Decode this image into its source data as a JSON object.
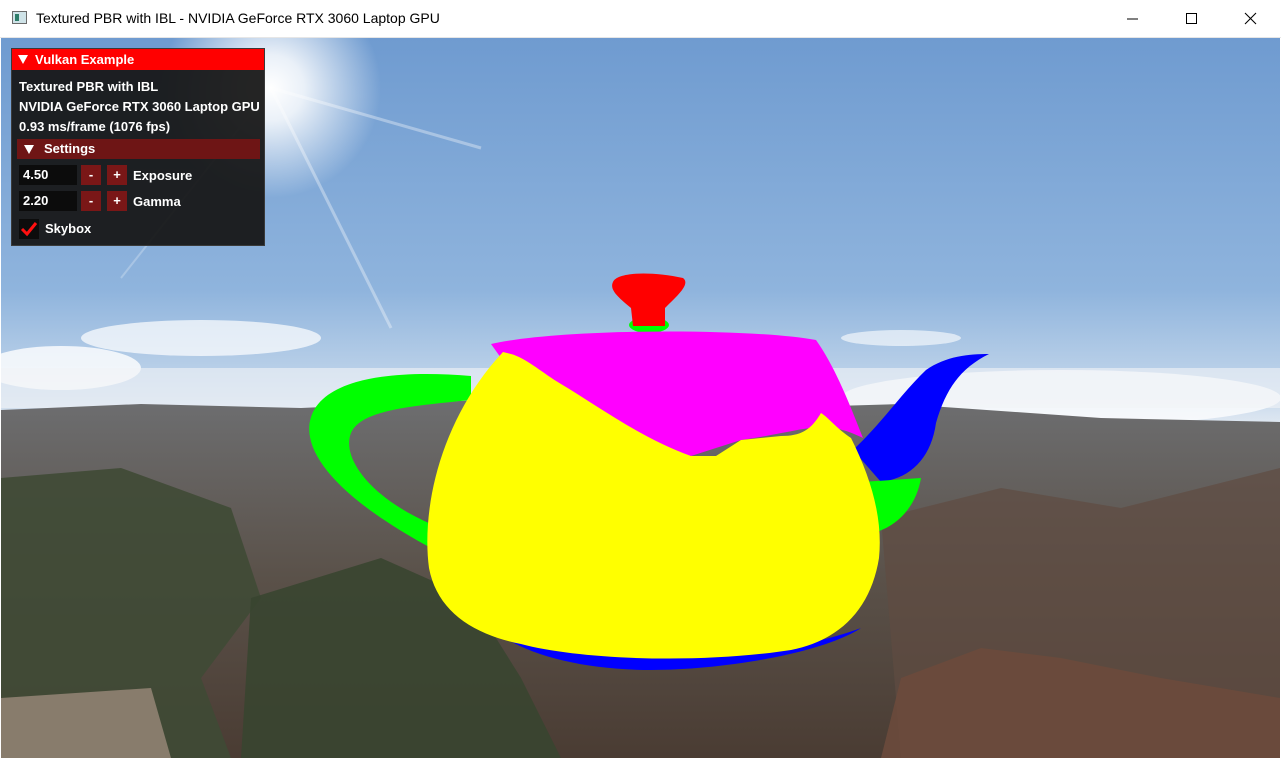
{
  "window": {
    "title": "Textured PBR with IBL - NVIDIA GeForce RTX 3060 Laptop GPU",
    "icons": {
      "app": "app-window-icon",
      "minimize": "minimize-icon",
      "maximize": "maximize-icon",
      "close": "close-icon"
    }
  },
  "overlay": {
    "header": "Vulkan Example",
    "sample_name": "Textured PBR with IBL",
    "device_name": "NVIDIA GeForce RTX 3060 Laptop GPU",
    "frame_stats": "0.93 ms/frame (1076 fps)",
    "settings": {
      "header": "Settings",
      "exposure": {
        "value": "4.50",
        "label": "Exposure",
        "minus": "-",
        "plus": "+"
      },
      "gamma": {
        "value": "2.20",
        "label": "Gamma",
        "minus": "-",
        "plus": "+"
      },
      "skybox": {
        "label": "Skybox",
        "checked": true
      }
    }
  },
  "colors": {
    "accent": "#ff0000",
    "settings_header": "#6e1515",
    "stepper": "#7a1717",
    "teapot_body": "#ffff00",
    "teapot_lid": "#ff00ff",
    "teapot_knob": "#ff0000",
    "teapot_handle": "#00ff00",
    "teapot_spout": "#0000ff"
  }
}
